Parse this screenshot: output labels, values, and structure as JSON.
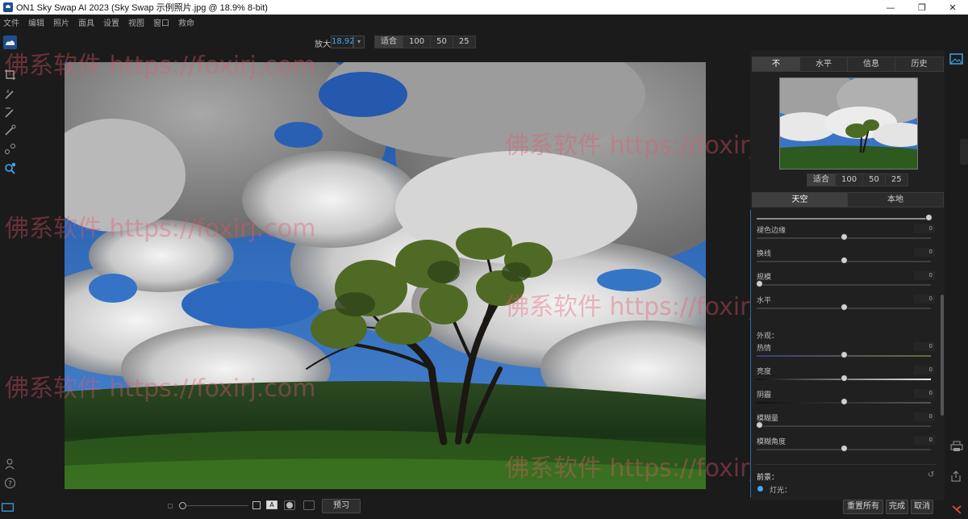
{
  "window": {
    "title": "ON1 Sky Swap AI 2023 (Sky Swap 示例照片.jpg @ 18.9% 8-bit)",
    "minimize": "—",
    "maximize": "❐",
    "close": "✕"
  },
  "menu": [
    "文件",
    "编辑",
    "照片",
    "面具",
    "设置",
    "视图",
    "窗口",
    "救命"
  ],
  "toolbar": {
    "zoom_label": "放大",
    "zoom_value": "18.92",
    "zoom_presets": [
      "适合",
      "100",
      "50",
      "25"
    ]
  },
  "panel": {
    "top_tabs": [
      "不",
      "水平",
      "信息",
      "历史"
    ],
    "nav_presets": [
      "适合",
      "100",
      "50",
      "25"
    ],
    "mode_tabs": [
      "天空",
      "本地"
    ],
    "sliders": [
      {
        "label": "",
        "value": ""
      },
      {
        "label": "褪色边缘",
        "value": "0"
      },
      {
        "label": "换线",
        "value": "0"
      },
      {
        "label": "规模",
        "value": "0"
      },
      {
        "label": "水平",
        "value": "0"
      }
    ],
    "section_appearance": "外观：",
    "appearance_sliders": [
      {
        "label": "热情",
        "value": "0"
      },
      {
        "label": "亮度",
        "value": "0"
      },
      {
        "label": "阴霾",
        "value": "0"
      },
      {
        "label": "模糊量",
        "value": "0"
      },
      {
        "label": "模糊角度",
        "value": "0"
      }
    ],
    "section_foreground": "前景：",
    "foreground_item": "灯光："
  },
  "bottom": {
    "preview_label": "预习",
    "reset_all": "重置所有",
    "done": "完成",
    "cancel": "取消"
  },
  "watermarks": [
    "佛系软件 https://foxirj.com",
    "佛系软件 https://foxirj.com",
    "佛系软件 https://foxirj.com",
    "佛系软件 https://foxirj.com",
    "佛系软件 https://foxirj.com",
    "佛系软件 https://foxirj.com"
  ],
  "colors": {
    "accent": "#3fa9f5",
    "sky": "#2a64b8",
    "grass": "#1f3d19",
    "watermark": "#e65a6e"
  }
}
